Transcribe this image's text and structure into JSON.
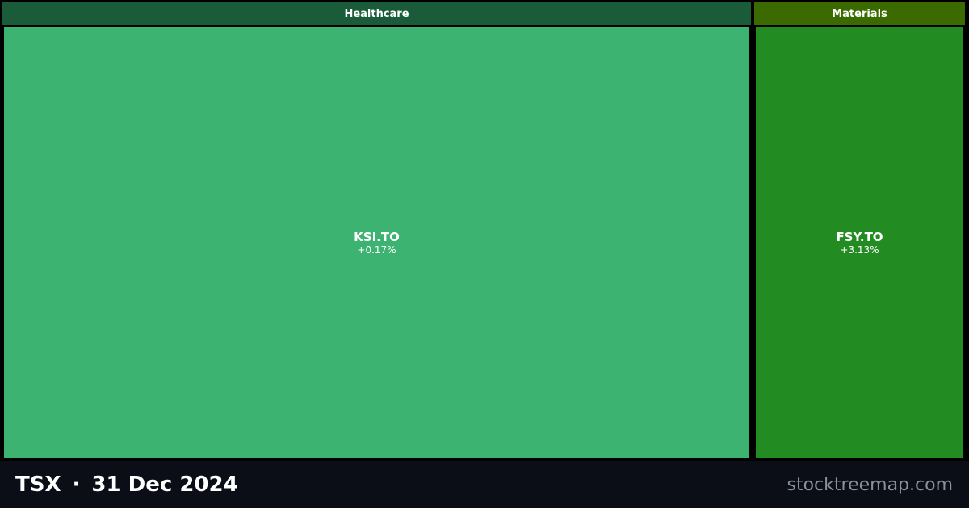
{
  "chart_data": {
    "type": "treemap",
    "sectors": [
      {
        "name": "Healthcare",
        "header_color": "#1a5c3a",
        "stocks": [
          {
            "ticker": "KSI.TO",
            "change": "+0.17%",
            "color": "#3cb371",
            "weight": 3.53
          }
        ]
      },
      {
        "name": "Materials",
        "header_color": "#3a6a00",
        "stocks": [
          {
            "ticker": "FSY.TO",
            "change": "+3.13%",
            "color": "#228b22",
            "weight": 1
          }
        ]
      }
    ]
  },
  "footer": {
    "exchange": "TSX",
    "separator": "·",
    "date": "31 Dec 2024",
    "site": "stocktreemap.com"
  }
}
